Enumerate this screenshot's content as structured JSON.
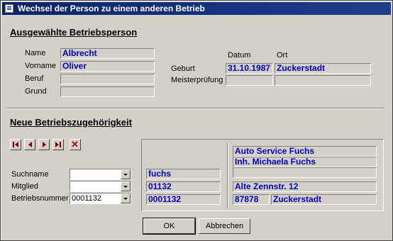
{
  "window": {
    "title": "Wechsel der Person zu einem anderen Betrieb"
  },
  "person": {
    "section_title": "Ausgewählte Betriebsperson",
    "name_label": "Name",
    "name_value": "Albrecht",
    "vorname_label": "Vorname",
    "vorname_value": "Oliver",
    "beruf_label": "Beruf",
    "beruf_value": "",
    "grund_label": "Grund",
    "grund_value": "",
    "datum_header": "Datum",
    "ort_header": "Ort",
    "geburt_label": "Geburt",
    "geburt_datum": "31.10.1987",
    "geburt_ort": "Zuckerstadt",
    "meister_label": "Meisterprüfung",
    "meister_datum": "",
    "meister_ort": ""
  },
  "new_company": {
    "section_title": "Neue Betriebszugehörigkeit",
    "suchname_label": "Suchname",
    "suchname_value": "",
    "mitglied_label": "Mitglied",
    "mitglied_value": "",
    "betriebsnummer_label": "Betriebsnummer",
    "betriebsnummer_value": "0001132",
    "result_suchname": "fuchs",
    "result_mitglied": "01132",
    "result_betriebsnummer": "0001132",
    "address_line1": "Auto Service Fuchs",
    "address_line2": "Inh. Michaela Fuchs",
    "address_line3": "",
    "street": "Alte Zennstr. 12",
    "plz": "87878",
    "city": "Zuckerstadt"
  },
  "buttons": {
    "ok": "OK",
    "cancel": "Abbrechen"
  },
  "colors": {
    "title_bar": "#0a246a",
    "field_text": "#0000c8",
    "background": "#d4d0c8",
    "nav_icon": "#800000"
  }
}
